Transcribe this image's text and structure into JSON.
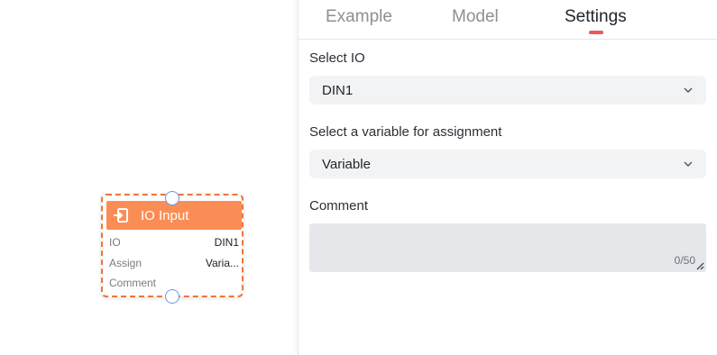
{
  "node": {
    "title": "IO Input",
    "icon": "io-input-icon",
    "header_color": "#f98d55",
    "border_color": "#f0743a",
    "rows": [
      {
        "label": "IO",
        "value": "DIN1"
      },
      {
        "label": "Assign",
        "value": "Varia..."
      },
      {
        "label": "Comment",
        "value": ""
      }
    ]
  },
  "panel": {
    "tabs": [
      {
        "label": "Example",
        "active": false
      },
      {
        "label": "Model",
        "active": false
      },
      {
        "label": "Settings",
        "active": true
      }
    ],
    "active_indicator_color": "#f2565b",
    "select_io": {
      "label": "Select IO",
      "value": "DIN1"
    },
    "select_variable": {
      "label": "Select a variable for assignment",
      "value": "Variable"
    },
    "comment": {
      "label": "Comment",
      "value": "",
      "counter": "0/50"
    }
  }
}
